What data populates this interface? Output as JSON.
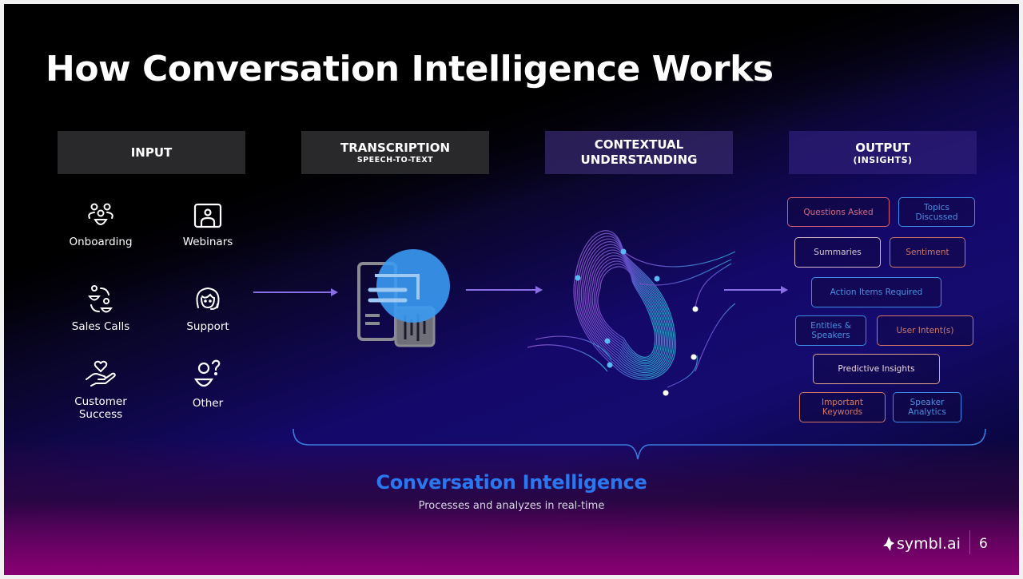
{
  "slide": {
    "title": "How Conversation Intelligence Works",
    "stages": [
      {
        "label": "INPUT",
        "sub": ""
      },
      {
        "label": "TRANSCRIPTION",
        "sub": "SPEECH-TO-TEXT"
      },
      {
        "label": "CONTEXTUAL",
        "sub": "UNDERSTANDING"
      },
      {
        "label": "OUTPUT",
        "sub": "(INSIGHTS)"
      }
    ],
    "inputs": [
      {
        "label": "Onboarding",
        "icon": "group-icon"
      },
      {
        "label": "Webinars",
        "icon": "presenter-screen-icon"
      },
      {
        "label": "Sales Calls",
        "icon": "exchange-people-icon"
      },
      {
        "label": "Support",
        "icon": "headset-agent-icon"
      },
      {
        "label": "Customer Success",
        "icon": "heart-hand-icon"
      },
      {
        "label": "Other",
        "icon": "person-question-icon"
      }
    ],
    "outputs": [
      {
        "label": "Questions Asked",
        "color": "#d65e73"
      },
      {
        "label": "Topics Discussed",
        "color": "#3d8de8"
      },
      {
        "label": "Summaries",
        "color": "#d8b8c8"
      },
      {
        "label": "Sentiment",
        "color": "#d27466"
      },
      {
        "label": "Action Items Required",
        "color": "#3d8de8"
      },
      {
        "label": "Entities & Speakers",
        "color": "#3d8de8"
      },
      {
        "label": "User Intent(s)",
        "color": "#d27466"
      },
      {
        "label": "Predictive Insights",
        "color": "#e0a58e"
      },
      {
        "label": "Important Keywords",
        "color": "#d27466"
      },
      {
        "label": "Speaker Analytics",
        "color": "#3d8de8"
      }
    ],
    "summary_title": "Conversation Intelligence",
    "summary_subtitle": "Processes and analyzes in real-time",
    "brand": "symbl.ai",
    "page_number": "6",
    "accent_color": "#2a77f0"
  }
}
